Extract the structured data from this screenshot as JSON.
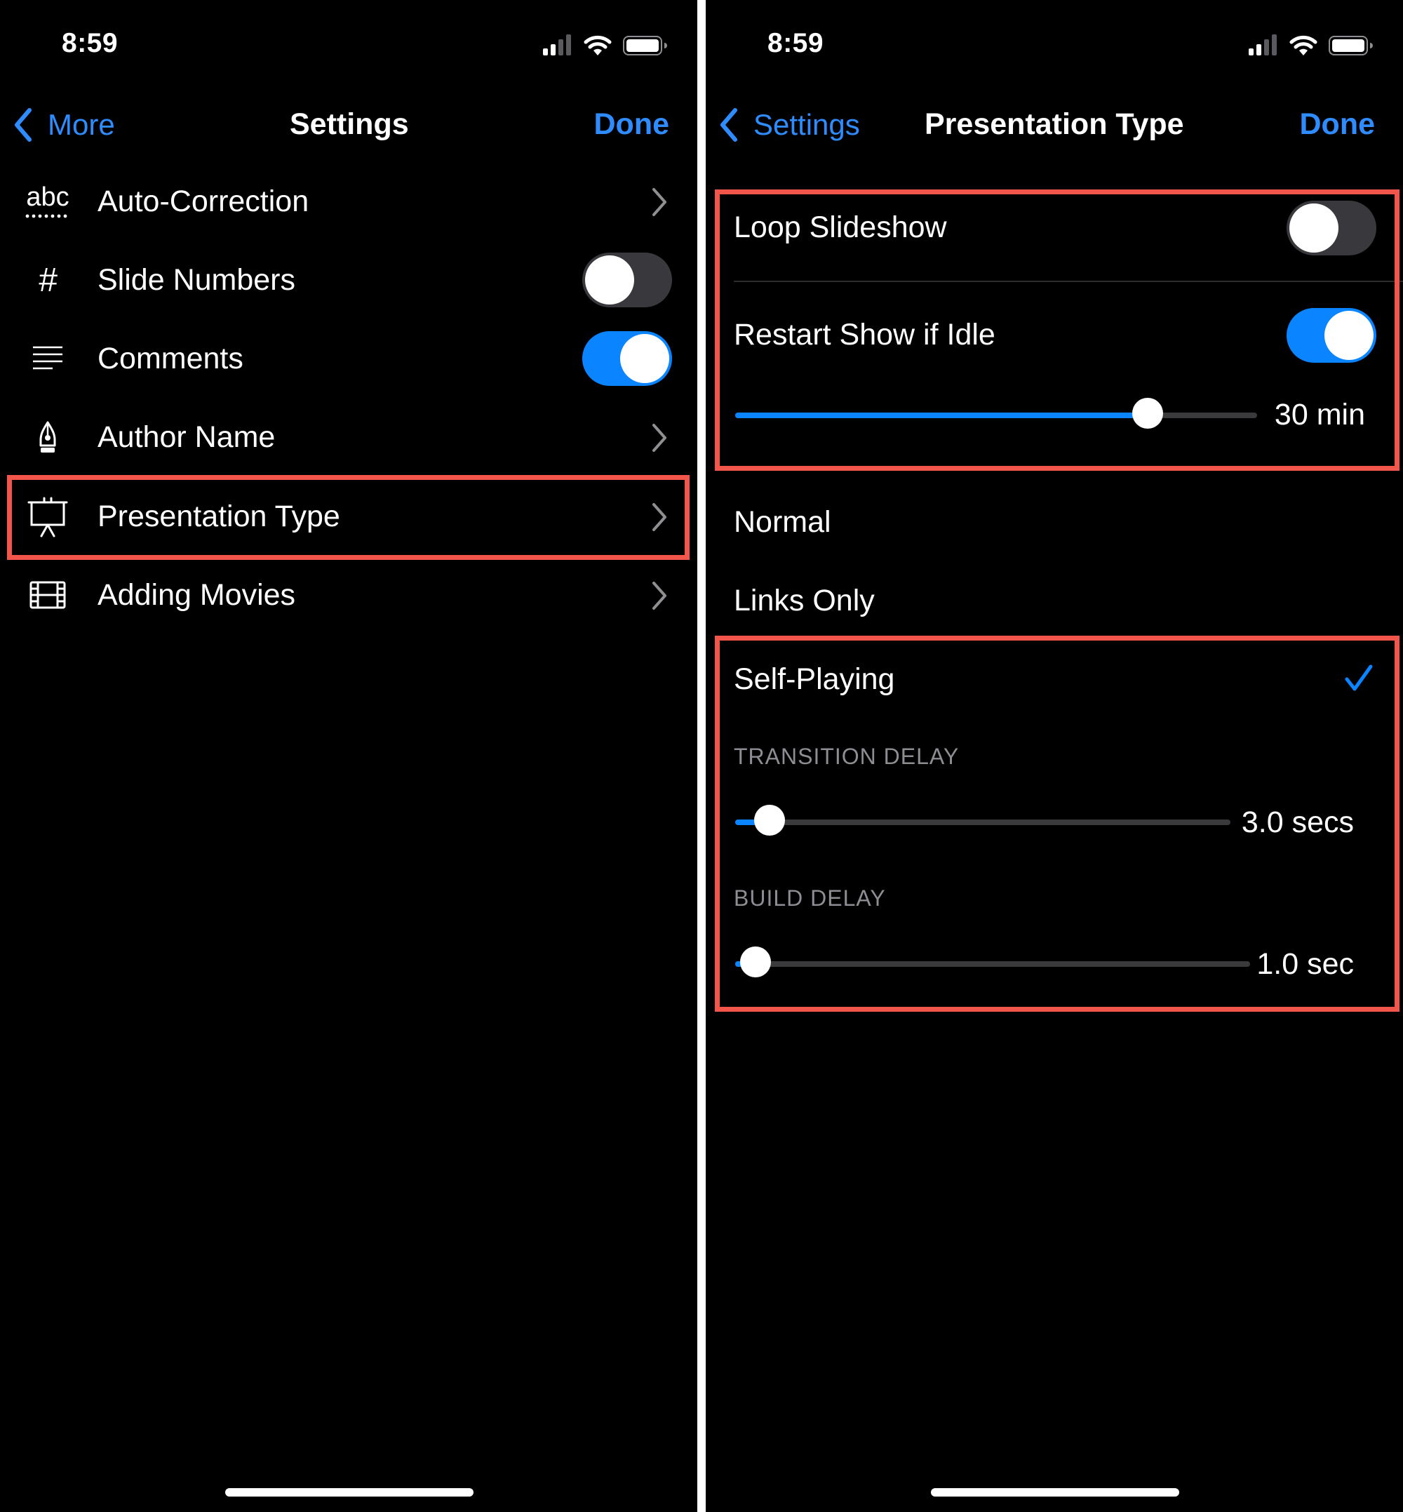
{
  "left": {
    "status": {
      "time": "8:59"
    },
    "nav": {
      "back_label": "More",
      "title": "Settings",
      "done_label": "Done"
    },
    "rows": [
      {
        "label": "Auto-Correction",
        "icon": "abc-icon",
        "icon_text": "abc",
        "accessory": "chevron"
      },
      {
        "label": "Slide Numbers",
        "icon": "hash-icon",
        "icon_text": "#",
        "accessory": "toggle",
        "toggle_on": false
      },
      {
        "label": "Comments",
        "icon": "comment-lines-icon",
        "accessory": "toggle",
        "toggle_on": true
      },
      {
        "label": "Author Name",
        "icon": "pen-nib-icon",
        "accessory": "chevron"
      },
      {
        "label": "Presentation Type",
        "icon": "presentation-easel-icon",
        "accessory": "chevron",
        "highlighted": true
      },
      {
        "label": "Adding Movies",
        "icon": "film-icon",
        "accessory": "chevron"
      }
    ]
  },
  "right": {
    "status": {
      "time": "8:59"
    },
    "nav": {
      "back_label": "Settings",
      "title": "Presentation Type",
      "done_label": "Done"
    },
    "loop_slideshow": {
      "label": "Loop Slideshow",
      "toggle_on": false
    },
    "restart_if_idle": {
      "label": "Restart Show if Idle",
      "toggle_on": true,
      "value_label": "30 min",
      "slider_fraction": 0.79
    },
    "options": [
      {
        "label": "Normal",
        "selected": false
      },
      {
        "label": "Links Only",
        "selected": false
      },
      {
        "label": "Self-Playing",
        "selected": true
      }
    ],
    "transition_delay": {
      "header": "TRANSITION DELAY",
      "value_label": "3.0 secs",
      "slider_fraction": 0.07
    },
    "build_delay": {
      "header": "BUILD DELAY",
      "value_label": "1.0 sec",
      "slider_fraction": 0.04
    }
  },
  "colors": {
    "accent": "#0a84ff",
    "highlight_box": "#f2564b",
    "background": "#000000",
    "toggle_off": "#39393d"
  }
}
